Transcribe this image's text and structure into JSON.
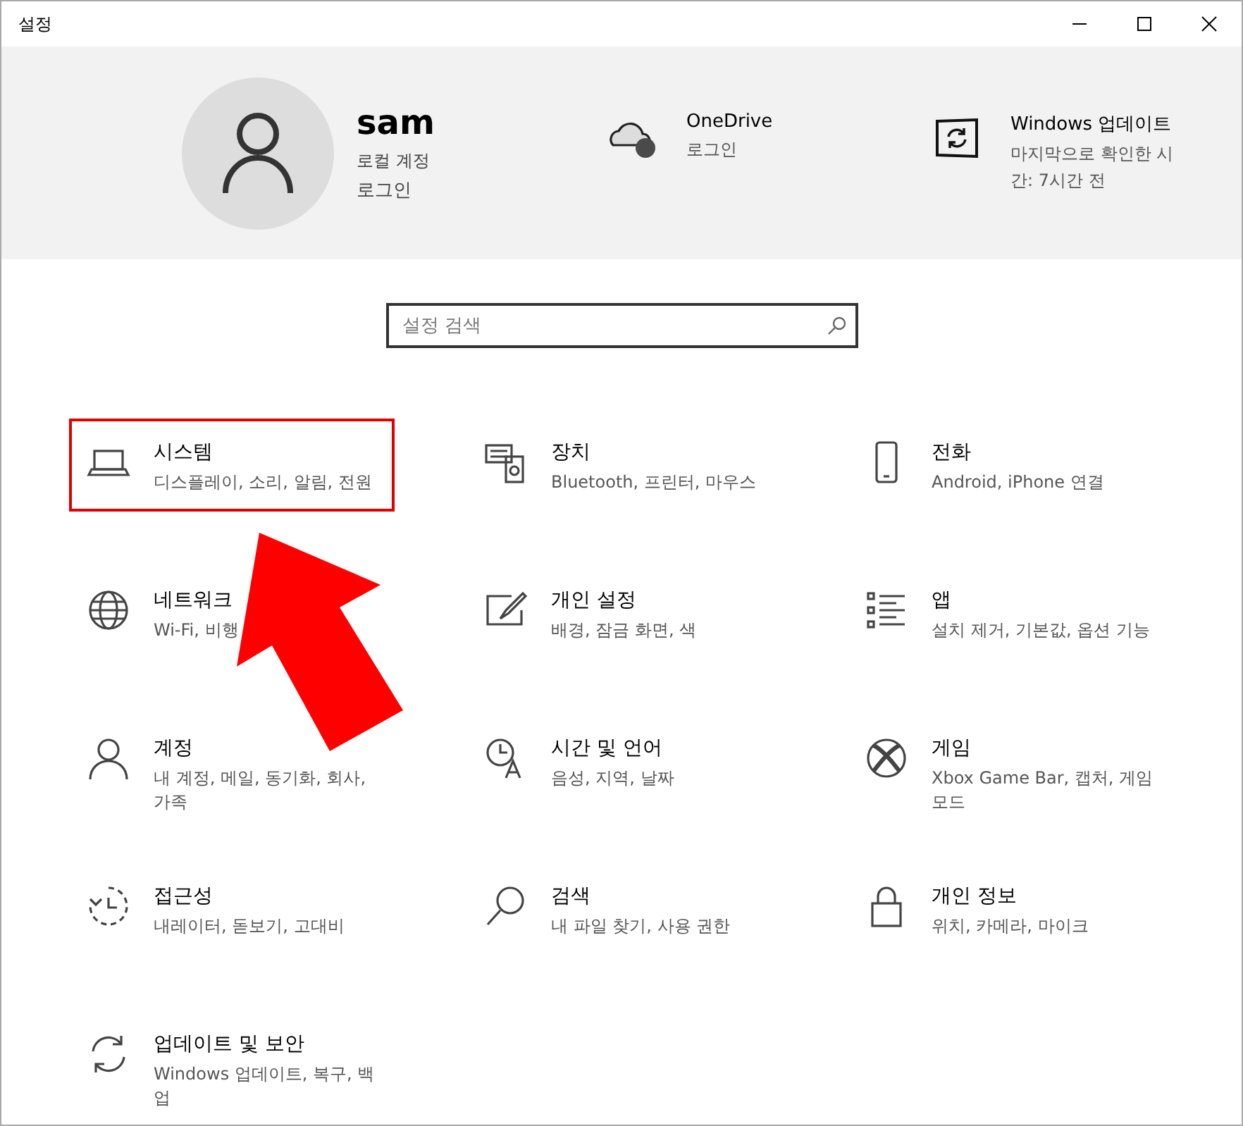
{
  "window": {
    "title": "설정"
  },
  "account": {
    "name": "sam",
    "type": "로컬 계정",
    "action": "로그인"
  },
  "header_items": [
    {
      "kind": "onedrive",
      "title": "OneDrive",
      "subtitle": "로그인"
    },
    {
      "kind": "update",
      "title": "Windows 업데이트",
      "subtitle": "마지막으로 확인한 시간: 7시간 전"
    }
  ],
  "search": {
    "placeholder": "설정 검색"
  },
  "categories": [
    {
      "kind": "laptop",
      "title": "시스템",
      "subtitle": "디스플레이, 소리, 알림, 전원",
      "highlighted": true
    },
    {
      "kind": "keyboard",
      "title": "장치",
      "subtitle": "Bluetooth, 프린터, 마우스",
      "highlighted": false
    },
    {
      "kind": "phone",
      "title": "전화",
      "subtitle": "Android, iPhone 연결",
      "highlighted": false
    },
    {
      "kind": "globe",
      "title": "네트워크",
      "subtitle": "Wi-Fi, 비행",
      "highlighted": false
    },
    {
      "kind": "paint",
      "title": "개인 설정",
      "subtitle": "배경, 잠금 화면, 색",
      "highlighted": false
    },
    {
      "kind": "apps",
      "title": "앱",
      "subtitle": "설치 제거, 기본값, 옵션 기능",
      "highlighted": false
    },
    {
      "kind": "person",
      "title": "계정",
      "subtitle": "내 계정, 메일, 동기화, 회사, 가족",
      "highlighted": false
    },
    {
      "kind": "time",
      "title": "시간 및 언어",
      "subtitle": "음성, 지역, 날짜",
      "highlighted": false
    },
    {
      "kind": "xbox",
      "title": "게임",
      "subtitle": "Xbox Game Bar, 캡처, 게임 모드",
      "highlighted": false
    },
    {
      "kind": "ease",
      "title": "접근성",
      "subtitle": "내레이터, 돋보기, 고대비",
      "highlighted": false
    },
    {
      "kind": "search",
      "title": "검색",
      "subtitle": "내 파일 찾기, 사용 권한",
      "highlighted": false
    },
    {
      "kind": "lock",
      "title": "개인 정보",
      "subtitle": "위치, 카메라, 마이크",
      "highlighted": false
    },
    {
      "kind": "sync",
      "title": "업데이트 및 보안",
      "subtitle": "Windows 업데이트, 복구, 백업",
      "highlighted": false
    }
  ]
}
